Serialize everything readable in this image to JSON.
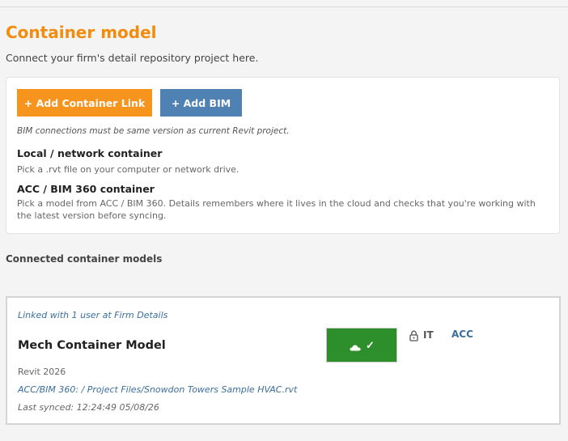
{
  "header": {
    "title": "Container model",
    "subtitle": "Connect your firm's detail repository project here."
  },
  "actions": {
    "add_container_link": "+ Add Container Link",
    "add_bim": "+ Add BIM",
    "note": "BIM connections must be same version as current Revit project."
  },
  "options": [
    {
      "title": "Local / network container",
      "description": "Pick a .rvt file on your computer or network drive."
    },
    {
      "title": "ACC / BIM 360 container",
      "description": "Pick a model from ACC / BIM 360. Details remembers where it lives in the cloud and checks that you're working with the latest version before syncing."
    }
  ],
  "connected": {
    "section_label": "Connected container models",
    "models": [
      {
        "linked_text": "Linked with 1 user at Firm Details",
        "name": "Mech Container Model",
        "revit_version": "Revit 2026",
        "path": "ACC/BIM 360:  / Project Files/Snowdon Towers Sample HVAC.rvt",
        "last_synced": "Last synced: 12:24:49  05/08/26",
        "sync_icon": "cloud-check-icon",
        "sync_check": "✓",
        "lock_icon": "lock-icon",
        "lock_label": "IT",
        "source_badge": "ACC"
      }
    ]
  },
  "colors": {
    "title_orange": "#f28c0f",
    "add_link_orange": "#f7941d",
    "add_bim_blue": "#4f81b3",
    "sync_green": "#2c8f2c",
    "link_blue": "#3a6e9c"
  }
}
